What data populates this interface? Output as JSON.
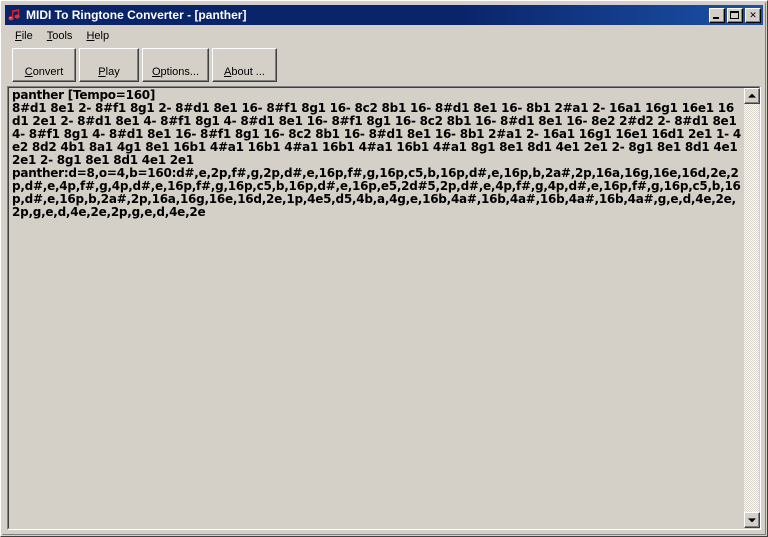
{
  "window": {
    "title": "MIDI To Ringtone Converter - [panther]",
    "icon": "music-note-icon",
    "caption_buttons": {
      "minimize": "minimize-icon",
      "maximize": "maximize-icon",
      "close": "✕"
    }
  },
  "menubar": {
    "items": [
      {
        "label": "File",
        "accel": "F",
        "rest": "ile"
      },
      {
        "label": "Tools",
        "accel": "T",
        "rest": "ools"
      },
      {
        "label": "Help",
        "accel": "H",
        "rest": "elp"
      }
    ]
  },
  "toolbar": {
    "convert": {
      "accel": "C",
      "rest": "onvert"
    },
    "play": {
      "accel": "P",
      "rest": "lay"
    },
    "options": {
      "accel": "O",
      "rest": "ptions..."
    },
    "about": {
      "accel": "A",
      "rest": "bout ..."
    }
  },
  "document": {
    "header": "panther [Tempo=160]",
    "note_lines": "8#d1 8e1 2- 8#f1 8g1 2- 8#d1 8e1 16- 8#f1 8g1 16- 8c2 8b1 16- 8#d1 8e1 16- 8b1 2#a1 2- 16a1 16g1 16e1 16d1 2e1 2- 8#d1 8e1 4- 8#f1 8g1 4- 8#d1 8e1 16- 8#f1 8g1 16- 8c2 8b1 16- 8#d1 8e1 16- 8e2 2#d2 2- 8#d1 8e1 4- 8#f1 8g1 4- 8#d1 8e1 16- 8#f1 8g1 16- 8c2 8b1 16- 8#d1 8e1 16- 8b1 2#a1 2- 16a1 16g1 16e1 16d1 2e1 1- 4e2 8d2 4b1 8a1 4g1 8e1 16b1 4#a1 16b1 4#a1 16b1 4#a1 16b1 4#a1 8g1 8e1 8d1 4e1 2e1 2- 8g1 8e1 8d1 4e1 2e1 2- 8g1 8e1 8d1 4e1 2e1",
    "rtttl": "panther:d=8,o=4,b=160:d#,e,2p,f#,g,2p,d#,e,16p,f#,g,16p,c5,b,16p,d#,e,16p,b,2a#,2p,16a,16g,16e,16d,2e,2p,d#,e,4p,f#,g,4p,d#,e,16p,f#,g,16p,c5,b,16p,d#,e,16p,e5,2d#5,2p,d#,e,4p,f#,g,4p,d#,e,16p,f#,g,16p,c5,b,16p,d#,e,16p,b,2a#,2p,16a,16g,16e,16d,2e,1p,4e5,d5,4b,a,4g,e,16b,4a#,16b,4a#,16b,4a#,16b,4a#,g,e,d,4e,2e,2p,g,e,d,4e,2e,2p,g,e,d,4e,2e"
  },
  "scrollbar": {
    "up": "scroll-up-icon",
    "down": "scroll-down-icon"
  }
}
